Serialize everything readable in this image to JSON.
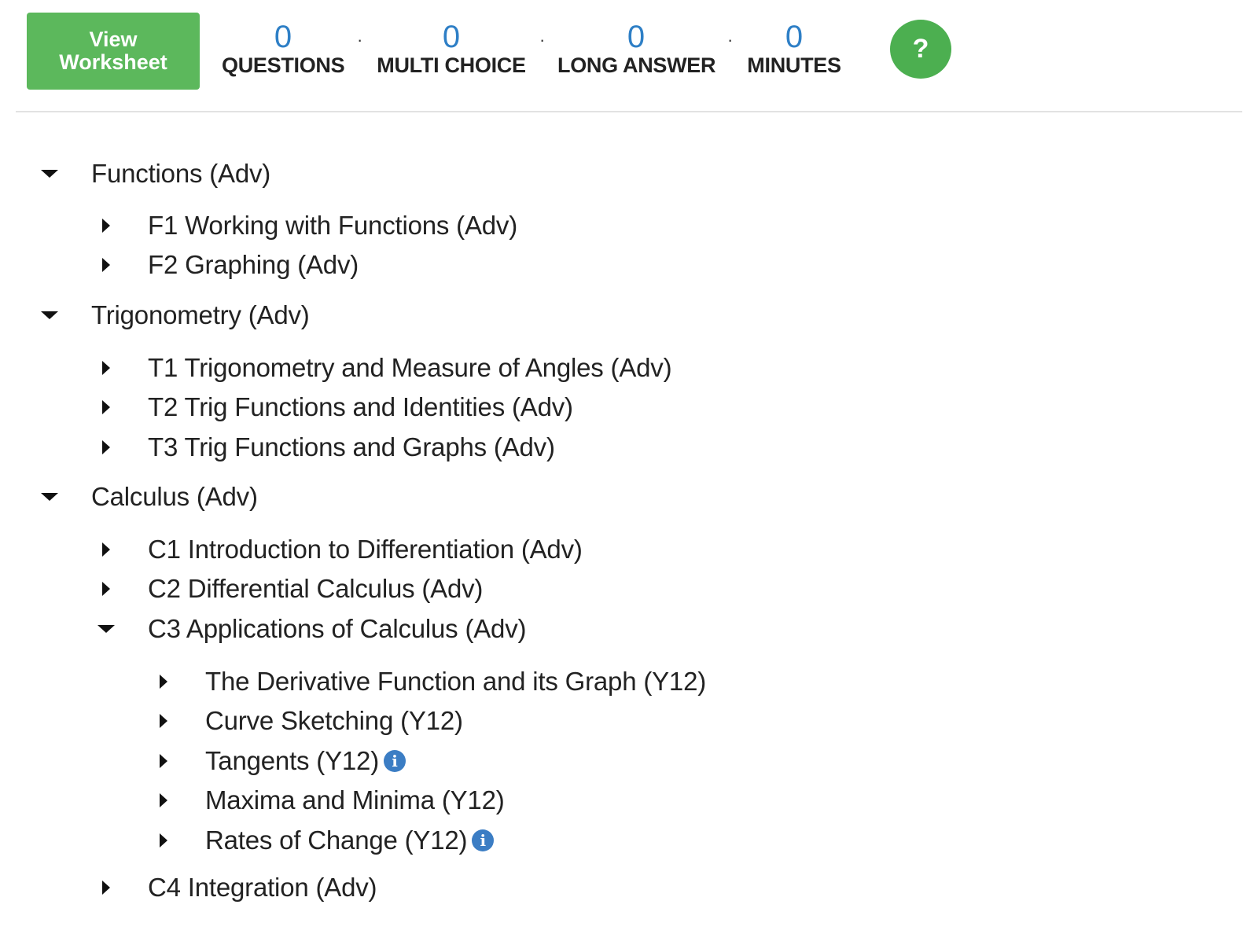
{
  "toolbar": {
    "view_worksheet_line1": "View",
    "view_worksheet_line2": "Worksheet",
    "stats": [
      {
        "value": "0",
        "label": "QUESTIONS"
      },
      {
        "value": "0",
        "label": "MULTI CHOICE"
      },
      {
        "value": "0",
        "label": "LONG ANSWER"
      },
      {
        "value": "0",
        "label": "MINUTES"
      }
    ],
    "separator": "·",
    "help_label": "?"
  },
  "tree": {
    "functions": {
      "label": "Functions (Adv)",
      "expanded": true,
      "children": [
        {
          "label": "F1 Working with Functions (Adv)",
          "expanded": false
        },
        {
          "label": "F2 Graphing (Adv)",
          "expanded": false
        }
      ]
    },
    "trigonometry": {
      "label": "Trigonometry (Adv)",
      "expanded": true,
      "children": [
        {
          "label": "T1 Trigonometry and Measure of Angles (Adv)",
          "expanded": false
        },
        {
          "label": "T2 Trig Functions and Identities (Adv)",
          "expanded": false
        },
        {
          "label": "T3 Trig Functions and Graphs (Adv)",
          "expanded": false
        }
      ]
    },
    "calculus": {
      "label": "Calculus (Adv)",
      "expanded": true,
      "children": [
        {
          "label": "C1 Introduction to Differentiation (Adv)",
          "expanded": false
        },
        {
          "label": "C2 Differential Calculus (Adv)",
          "expanded": false
        },
        {
          "label": "C3 Applications of Calculus (Adv)",
          "expanded": true,
          "children": [
            {
              "label": "The Derivative Function and its Graph (Y12)",
              "info": false
            },
            {
              "label": "Curve Sketching (Y12)",
              "info": false
            },
            {
              "label": "Tangents (Y12)",
              "info": true
            },
            {
              "label": "Maxima and Minima (Y12)",
              "info": false
            },
            {
              "label": "Rates of Change (Y12)",
              "info": true
            }
          ]
        },
        {
          "label": "C4 Integration (Adv)",
          "expanded": false
        }
      ]
    }
  },
  "info_glyph": "i",
  "colors": {
    "primary_green": "#5cb85c",
    "help_green": "#4caf50",
    "stat_blue": "#2e7fc6",
    "info_blue": "#3b7dc4",
    "text": "#222222"
  }
}
